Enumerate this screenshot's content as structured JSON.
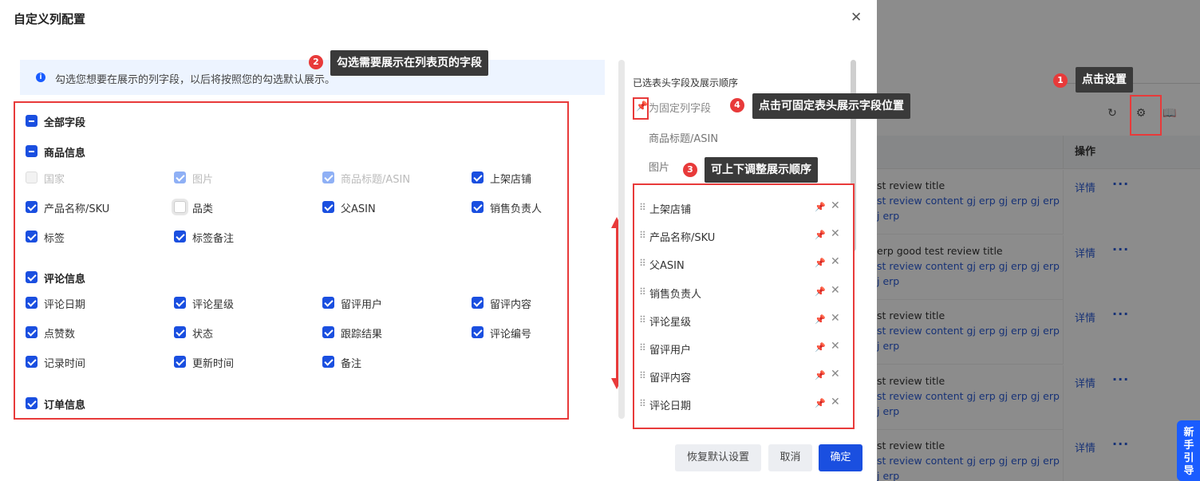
{
  "dialog": {
    "title": "自定义列配置",
    "close_icon": "close-icon",
    "info_text": "勾选您想要在展示的列字段，以后将按照您的勾选默认展示。"
  },
  "groups": {
    "all_fields": "全部字段",
    "product": {
      "title": "商品信息",
      "items": [
        "国家",
        "图片",
        "商品标题/ASIN",
        "上架店铺",
        "产品名称/SKU",
        "品类",
        "父ASIN",
        "销售负责人",
        "标签",
        "标签备注"
      ]
    },
    "review": {
      "title": "评论信息",
      "items": [
        "评论日期",
        "评论星级",
        "留评用户",
        "留评内容",
        "点赞数",
        "状态",
        "跟踪结果",
        "评论编号",
        "记录时间",
        "更新时间",
        "备注"
      ]
    },
    "order": {
      "title": "订单信息"
    }
  },
  "right_panel": {
    "title": "已选表头字段及展示顺序",
    "fixed_label": "为固定列字段",
    "fixed_items": [
      "商品标题/ASIN",
      "图片"
    ],
    "ordered_items": [
      "上架店铺",
      "产品名称/SKU",
      "父ASIN",
      "销售负责人",
      "评论星级",
      "留评用户",
      "留评内容",
      "评论日期"
    ]
  },
  "buttons": {
    "reset": "恢复默认设置",
    "cancel": "取消",
    "confirm": "确定"
  },
  "callouts": {
    "c1": {
      "num": "1",
      "text": "点击设置"
    },
    "c2": {
      "num": "2",
      "text": "勾选需要展示在列表页的字段"
    },
    "c3": {
      "num": "3",
      "text": "可上下调整展示顺序"
    },
    "c4": {
      "num": "4",
      "text": "点击可固定表头展示字段位置"
    }
  },
  "background": {
    "op_header": "操作",
    "rows": [
      {
        "t1": "st review title",
        "t2": "st review content gj erp gj erp gj erp",
        "t3": "j erp",
        "link": "详情"
      },
      {
        "t1": "erp good test review title",
        "t2": "st review content gj erp gj erp gj erp",
        "t3": "j erp",
        "link": "详情"
      },
      {
        "t1": "st review title",
        "t2": "st review content gj erp gj erp gj erp",
        "t3": "j erp",
        "link": "详情"
      },
      {
        "t1": "st review title",
        "t2": "st review content gj erp gj erp gj erp",
        "t3": "j erp",
        "link": "详情"
      },
      {
        "t1": "st review title",
        "t2": "st review content gj erp gj erp gj erp",
        "t3": "j erp",
        "link": "详情"
      }
    ],
    "guide_text": "新手引导"
  },
  "colors": {
    "primary": "#1a4fe0",
    "annotation_red": "#e83a3a",
    "tooltip_bg": "#3a3a3a"
  }
}
